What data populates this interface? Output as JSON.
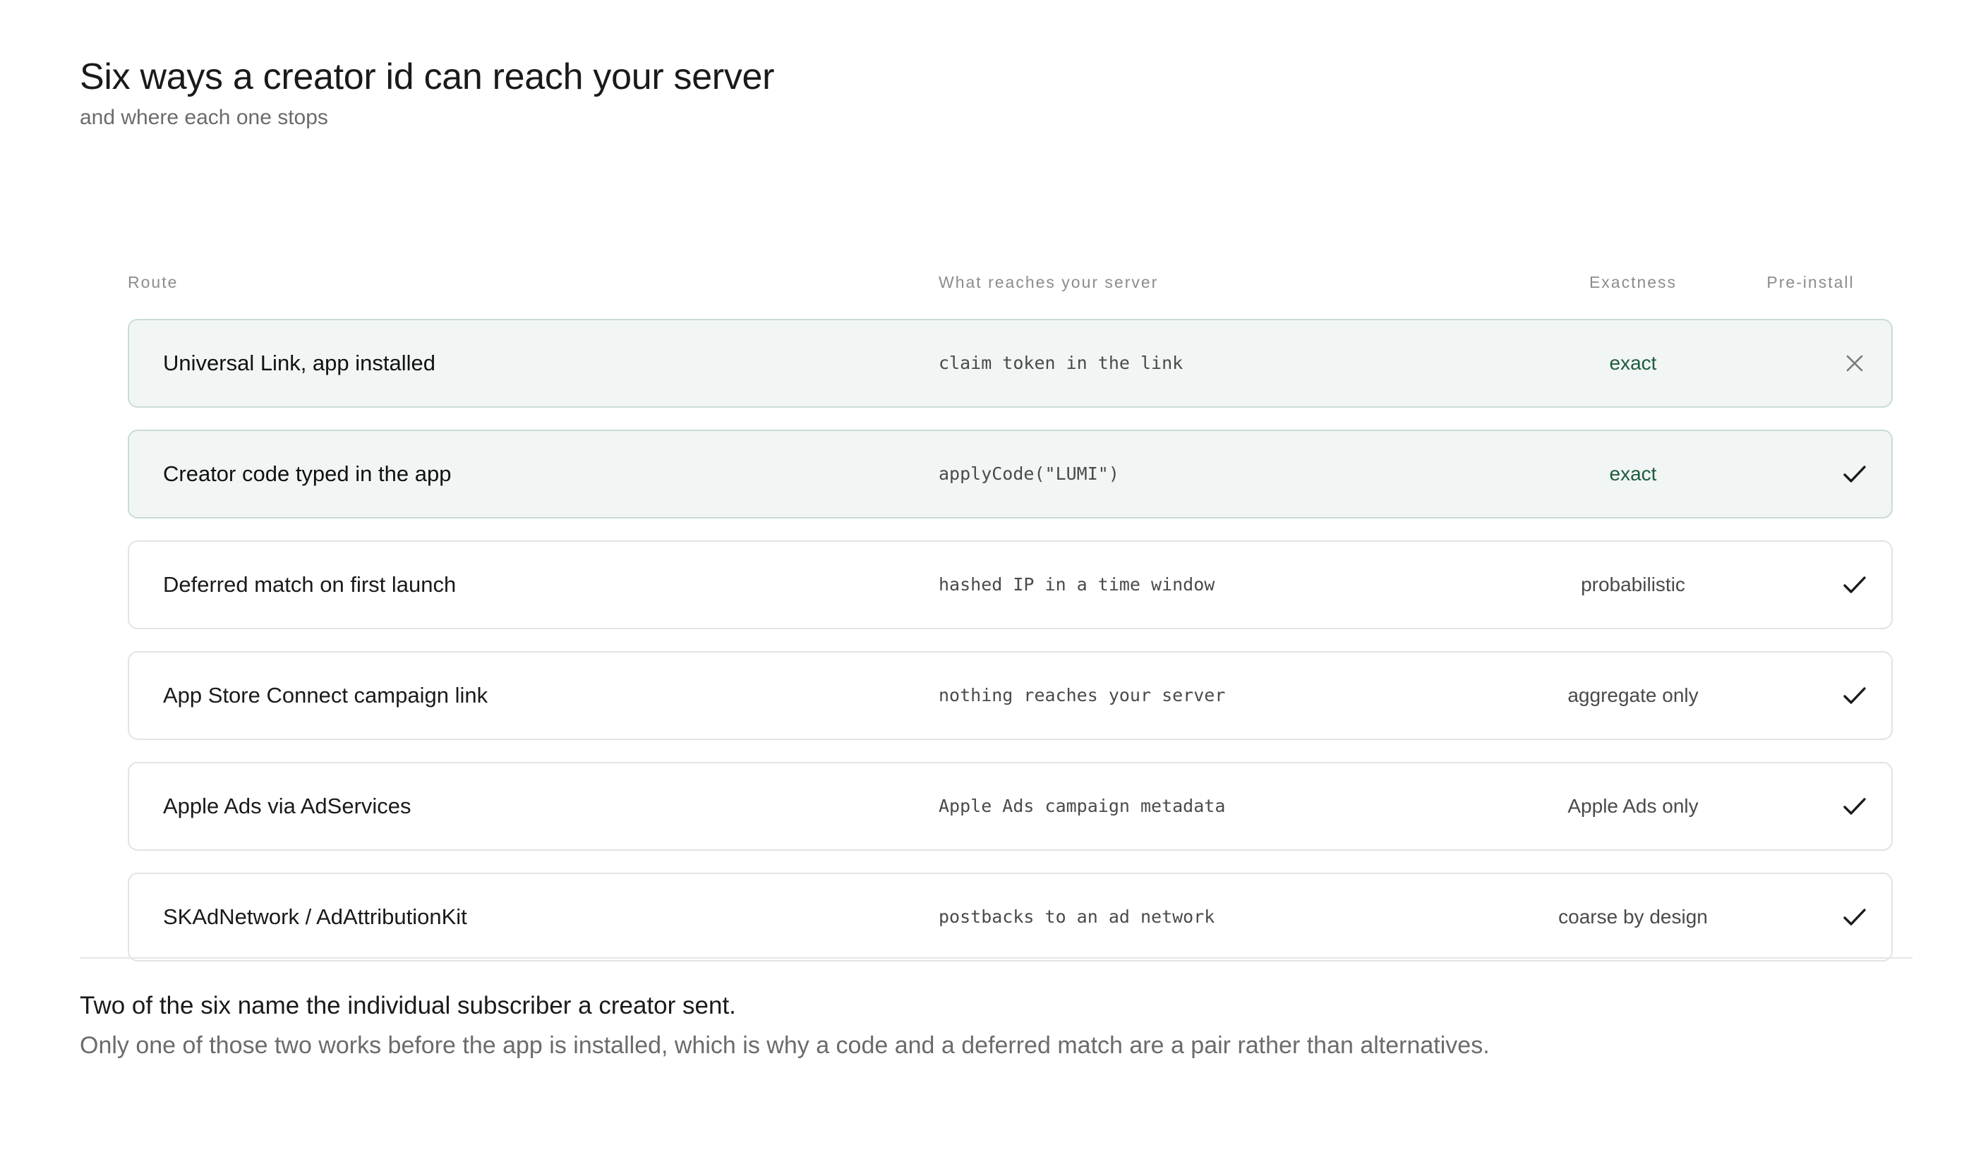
{
  "header": {
    "title": "Six ways a creator id can reach your server",
    "subtitle": "and where each one stops"
  },
  "columns": {
    "route": "Route",
    "server": "What reaches your server",
    "exactness": "Exactness",
    "preinstall": "Pre-install"
  },
  "rows": [
    {
      "route": "Universal Link, app installed",
      "server": "claim token in the link",
      "exactness": "exact",
      "preinstall_icon": "cross-icon",
      "highlighted": true
    },
    {
      "route": "Creator code typed in the app",
      "server": "applyCode(\"LUMI\")",
      "exactness": "exact",
      "preinstall_icon": "check-icon",
      "highlighted": true
    },
    {
      "route": "Deferred match on first launch",
      "server": "hashed IP in a time window",
      "exactness": "probabilistic",
      "preinstall_icon": "check-icon",
      "highlighted": false
    },
    {
      "route": "App Store Connect campaign link",
      "server": "nothing reaches your server",
      "exactness": "aggregate only",
      "preinstall_icon": "check-icon",
      "highlighted": false
    },
    {
      "route": "Apple Ads via AdServices",
      "server": "Apple Ads campaign metadata",
      "exactness": "Apple Ads only",
      "preinstall_icon": "check-icon",
      "highlighted": false
    },
    {
      "route": "SKAdNetwork / AdAttributionKit",
      "server": "postbacks to an ad network",
      "exactness": "coarse by design",
      "preinstall_icon": "check-icon",
      "highlighted": false
    }
  ],
  "footer": {
    "headline": "Two of the six name the individual subscriber a creator sent.",
    "body": "Only one of those two works before the app is installed, which is why a code and a deferred match are a pair rather than alternatives."
  },
  "colors": {
    "highlight_bg": "#f1f5f3",
    "highlight_border": "#c9ddd3",
    "exact_text": "#1e5c3f"
  }
}
